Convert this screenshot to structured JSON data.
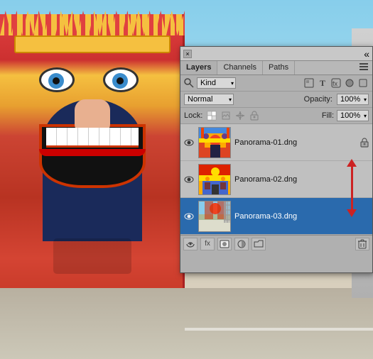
{
  "background": {
    "description": "Carnival entrance with face decoration"
  },
  "panel": {
    "title": "",
    "close_label": "×",
    "tabs": [
      {
        "label": "Layers",
        "active": true
      },
      {
        "label": "Channels",
        "active": false
      },
      {
        "label": "Paths",
        "active": false
      }
    ],
    "menu_icon": "≡",
    "kind_label": "Kind",
    "kind_icons": [
      "🔷",
      "T",
      "Fx",
      "🎨"
    ],
    "blend_mode": "Normal",
    "blend_mode_arrow": "▾",
    "opacity_label": "Opacity:",
    "opacity_value": "100%",
    "opacity_arrow": "▾",
    "lock_label": "Lock:",
    "lock_icons": [
      "□",
      "✎",
      "↔",
      "🔒"
    ],
    "fill_label": "Fill:",
    "fill_value": "100%",
    "fill_arrow": "▾",
    "layers": [
      {
        "id": 1,
        "name": "Panorama-01.dng",
        "visible": true,
        "locked": true,
        "selected": false
      },
      {
        "id": 2,
        "name": "Panorama-02.dng",
        "visible": true,
        "locked": false,
        "selected": false
      },
      {
        "id": 3,
        "name": "Panorama-03.dng",
        "visible": true,
        "locked": false,
        "selected": true
      }
    ],
    "toolbar_icons": [
      "🔗",
      "fx",
      "□",
      "◎",
      "📁",
      "🗑"
    ]
  }
}
